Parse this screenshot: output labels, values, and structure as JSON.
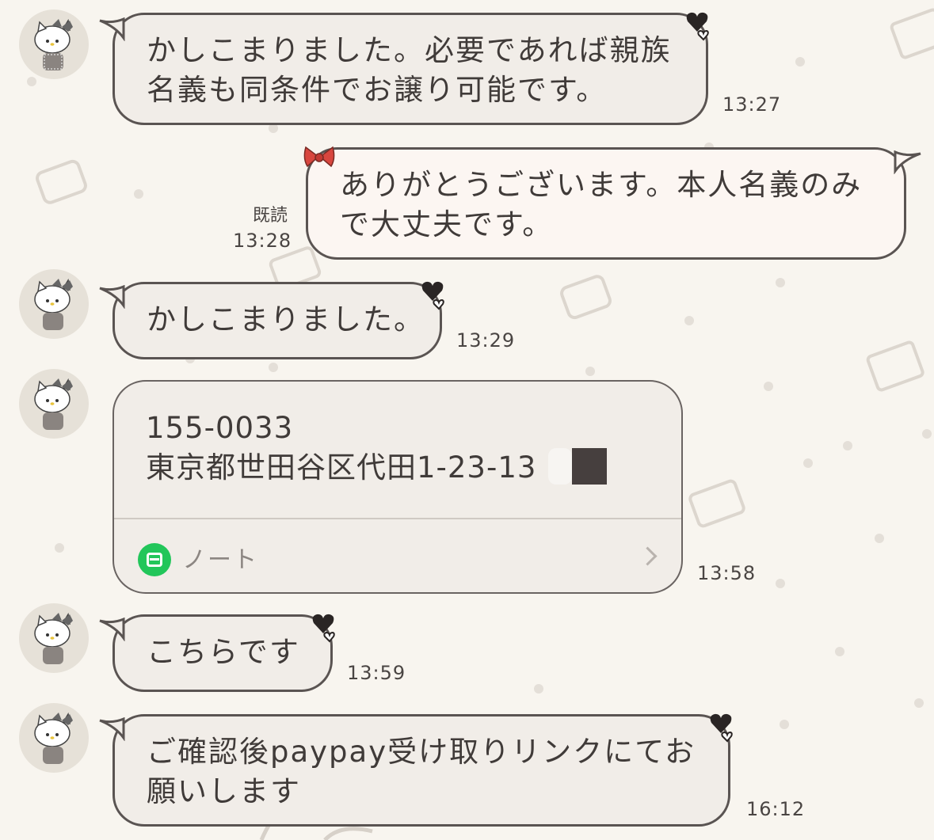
{
  "messages": [
    {
      "id": "m1",
      "text": "かしこまりました。必要であれば親族\n名義も同条件でお譲り可能です。",
      "time": "13:27"
    },
    {
      "id": "m2",
      "text": "ありがとうございます。本人名義のみ\nで大丈夫です。",
      "time": "13:28",
      "read": "既読"
    },
    {
      "id": "m3",
      "text": "かしこまりました。",
      "time": "13:29"
    },
    {
      "id": "m4",
      "postal": "155-0033",
      "address": "東京都世田谷区代田1-23-13",
      "note_label": "ノート",
      "time": "13:58"
    },
    {
      "id": "m5",
      "text": "こちらです",
      "time": "13:59"
    },
    {
      "id": "m6",
      "text": "ご確認後paypay受け取りリンクにてお\n願いします",
      "time": "16:12"
    }
  ],
  "icons": {
    "avatar": "hello-kitty-avatar",
    "note": "note-icon",
    "bow": "red-bow-icon",
    "heart": "heart-icon",
    "chevron": "chevron-right-icon"
  },
  "colors": {
    "background": "#f8f5ef",
    "bubble_in": "#f1ede8",
    "bubble_out": "#fcf6f2",
    "border": "#5a5452",
    "note_green": "#22c65a",
    "bow_red": "#d8463e"
  }
}
